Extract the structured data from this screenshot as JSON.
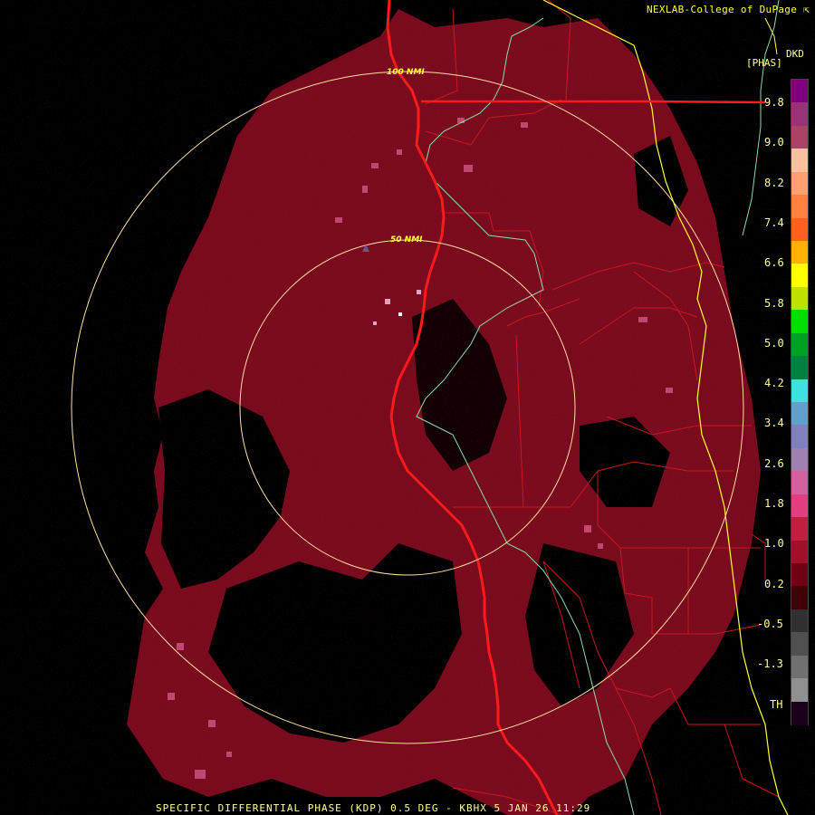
{
  "header": {
    "credit": "NEXLAB-College of DuPage",
    "credit_icon": "arrow-corner-icon",
    "product": "DKD",
    "product_sub": "[PHAS]"
  },
  "footer": {
    "caption": "SPECIFIC DIFFERENTIAL PHASE (KDP) 0.5 DEG - KBHX 5 JAN 26 11:29"
  },
  "range_rings": [
    {
      "label": "100 NMI"
    },
    {
      "label": "50 NMI"
    }
  ],
  "colors": {
    "background": "#000000",
    "echo_dark": "#5a000f",
    "echo_main": "#7a0a1e",
    "echo_light": "#a0284a",
    "echo_pink": "#e07090",
    "highway": "#ff1a1a",
    "county_border": "#c81818",
    "state_border": "#ffff33",
    "coast_line": "#8fd8b0",
    "ring": "#ffe0a0"
  },
  "scale": {
    "labels": [
      "9.8",
      "9.0",
      "8.2",
      "7.4",
      "6.6",
      "5.8",
      "5.0",
      "4.2",
      "3.4",
      "2.6",
      "1.8",
      "1.0",
      "0.2",
      "-0.5",
      "-1.3",
      "TH"
    ],
    "swatches": [
      "#800080",
      "#993377",
      "#aa4466",
      "#ffc0a0",
      "#ffa070",
      "#ff8040",
      "#ff6020",
      "#ffb000",
      "#ffff00",
      "#c0e000",
      "#00dd00",
      "#00a020",
      "#008040",
      "#40e0e0",
      "#60a0d0",
      "#8080c0",
      "#a080b0",
      "#d060a0",
      "#e04080",
      "#c02040",
      "#a01028",
      "#700014",
      "#400008",
      "#303030",
      "#505050",
      "#707070",
      "#909090",
      "#1a001a"
    ]
  }
}
